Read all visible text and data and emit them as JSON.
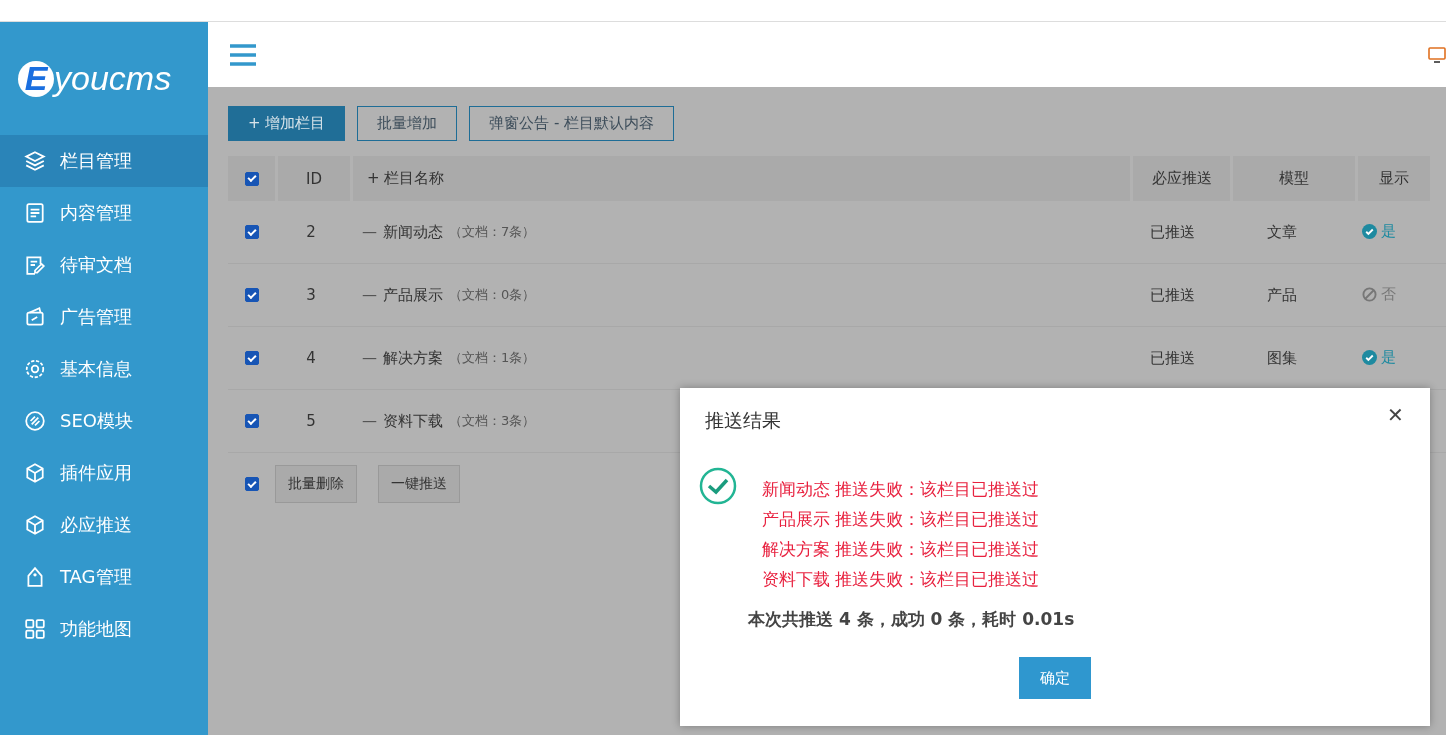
{
  "sidebar": {
    "logo_letter": "E",
    "logo_text": "youcms",
    "items": [
      {
        "label": "栏目管理",
        "selected": true
      },
      {
        "label": "内容管理",
        "selected": false
      },
      {
        "label": "待审文档",
        "selected": false
      },
      {
        "label": "广告管理",
        "selected": false
      },
      {
        "label": "基本信息",
        "selected": false
      },
      {
        "label": "SEO模块",
        "selected": false
      },
      {
        "label": "插件应用",
        "selected": false
      },
      {
        "label": "必应推送",
        "selected": false
      },
      {
        "label": "TAG管理",
        "selected": false
      },
      {
        "label": "功能地图",
        "selected": false
      }
    ]
  },
  "toolbar": {
    "buttons": [
      {
        "label": "增加栏目",
        "kind": "primary",
        "icon": "+"
      },
      {
        "label": "批量增加",
        "kind": "outline"
      },
      {
        "label": "弹窗公告 - 栏目默认内容",
        "kind": "outline"
      }
    ]
  },
  "table": {
    "select_all_checked": true,
    "columns": [
      "ID",
      "栏目名称",
      "必应推送",
      "模型",
      "显示"
    ],
    "name_column_icon": "+",
    "rows": [
      {
        "checked": true,
        "id": "2",
        "prefix": "—",
        "name": "新闻动态",
        "count": "（文档：7条）",
        "push": "已推送",
        "model": "文章",
        "show": true,
        "show_label": "是"
      },
      {
        "checked": true,
        "id": "3",
        "prefix": "—",
        "name": "产品展示",
        "count": "（文档：0条）",
        "push": "已推送",
        "model": "产品",
        "show": false,
        "show_label": "否"
      },
      {
        "checked": true,
        "id": "4",
        "prefix": "—",
        "name": "解决方案",
        "count": "（文档：1条）",
        "push": "已推送",
        "model": "图集",
        "show": true,
        "show_label": "是"
      },
      {
        "checked": true,
        "id": "5",
        "prefix": "—",
        "name": "资料下载",
        "count": "（文档：3条）"
      }
    ],
    "footer": {
      "checked": true,
      "buttons": [
        "批量删除",
        "一键推送"
      ]
    }
  },
  "dialog": {
    "title": "推送结果",
    "close": "✕",
    "messages": [
      "新闻动态 推送失败：该栏目已推送过",
      "产品展示 推送失败：该栏目已推送过",
      "解决方案 推送失败：该栏目已推送过",
      "资料下载 推送失败：该栏目已推送过"
    ],
    "summary": "本次共推送 4 条，成功 0 条，耗时 0.01s",
    "confirm": "确定"
  }
}
